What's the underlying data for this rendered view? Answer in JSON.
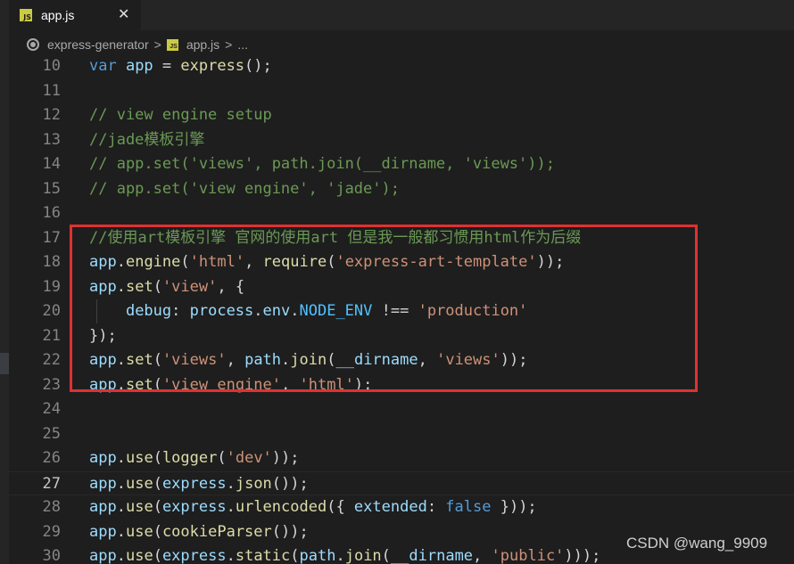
{
  "tab": {
    "label": "app.js",
    "close": "✕",
    "badge": "JS"
  },
  "breadcrumb": {
    "items": [
      "express-generator",
      "app.js",
      "..."
    ],
    "sep": ">",
    "badge": "JS"
  },
  "editor": {
    "lines": [
      {
        "n": "10",
        "code": [
          [
            "k",
            "var "
          ],
          [
            "v",
            "app"
          ],
          [
            "o",
            " = "
          ],
          [
            "f",
            "express"
          ],
          [
            "p",
            "();"
          ]
        ]
      },
      {
        "n": "11",
        "code": []
      },
      {
        "n": "12",
        "code": [
          [
            "c",
            "// view engine setup"
          ]
        ]
      },
      {
        "n": "13",
        "code": [
          [
            "c",
            "//jade模板引擎"
          ]
        ]
      },
      {
        "n": "14",
        "code": [
          [
            "c",
            "// app.set('views', path.join(__dirname, 'views'));"
          ]
        ]
      },
      {
        "n": "15",
        "code": [
          [
            "c",
            "// app.set('view engine', 'jade');"
          ]
        ]
      },
      {
        "n": "16",
        "code": []
      },
      {
        "n": "17",
        "code": [
          [
            "c",
            "//使用art模板引擎 官网的使用art 但是我一般都习惯用html作为后缀"
          ]
        ]
      },
      {
        "n": "18",
        "code": [
          [
            "v",
            "app"
          ],
          [
            "p",
            "."
          ],
          [
            "f",
            "engine"
          ],
          [
            "p",
            "("
          ],
          [
            "s",
            "'html'"
          ],
          [
            "p",
            ", "
          ],
          [
            "f",
            "require"
          ],
          [
            "p",
            "("
          ],
          [
            "s",
            "'express-art-template'"
          ],
          [
            "p",
            "));"
          ]
        ]
      },
      {
        "n": "19",
        "code": [
          [
            "v",
            "app"
          ],
          [
            "p",
            "."
          ],
          [
            "f",
            "set"
          ],
          [
            "p",
            "("
          ],
          [
            "s",
            "'view'"
          ],
          [
            "p",
            ", {"
          ]
        ]
      },
      {
        "n": "20",
        "code": [
          [
            "p",
            "    "
          ],
          [
            "v",
            "debug"
          ],
          [
            "p",
            ": "
          ],
          [
            "v",
            "process"
          ],
          [
            "p",
            "."
          ],
          [
            "v",
            "env"
          ],
          [
            "p",
            "."
          ],
          [
            "con",
            "NODE_ENV"
          ],
          [
            "o",
            " !== "
          ],
          [
            "s",
            "'production'"
          ]
        ],
        "guide": true
      },
      {
        "n": "21",
        "code": [
          [
            "p",
            "});"
          ]
        ]
      },
      {
        "n": "22",
        "code": [
          [
            "v",
            "app"
          ],
          [
            "p",
            "."
          ],
          [
            "f",
            "set"
          ],
          [
            "p",
            "("
          ],
          [
            "s",
            "'views'"
          ],
          [
            "p",
            ", "
          ],
          [
            "v",
            "path"
          ],
          [
            "p",
            "."
          ],
          [
            "f",
            "join"
          ],
          [
            "p",
            "("
          ],
          [
            "v",
            "__dirname"
          ],
          [
            "p",
            ", "
          ],
          [
            "s",
            "'views'"
          ],
          [
            "p",
            "));"
          ]
        ]
      },
      {
        "n": "23",
        "code": [
          [
            "v",
            "app"
          ],
          [
            "p",
            "."
          ],
          [
            "f",
            "set"
          ],
          [
            "p",
            "("
          ],
          [
            "s",
            "'view engine'"
          ],
          [
            "p",
            ", "
          ],
          [
            "s",
            "'html'"
          ],
          [
            "p",
            ");"
          ]
        ]
      },
      {
        "n": "24",
        "code": []
      },
      {
        "n": "25",
        "code": []
      },
      {
        "n": "26",
        "code": [
          [
            "v",
            "app"
          ],
          [
            "p",
            "."
          ],
          [
            "f",
            "use"
          ],
          [
            "p",
            "("
          ],
          [
            "f",
            "logger"
          ],
          [
            "p",
            "("
          ],
          [
            "s",
            "'dev'"
          ],
          [
            "p",
            "));"
          ]
        ]
      },
      {
        "n": "27",
        "code": [
          [
            "v",
            "app"
          ],
          [
            "p",
            "."
          ],
          [
            "f",
            "use"
          ],
          [
            "p",
            "("
          ],
          [
            "v",
            "express"
          ],
          [
            "p",
            "."
          ],
          [
            "f",
            "json"
          ],
          [
            "p",
            "());"
          ]
        ],
        "current": true
      },
      {
        "n": "28",
        "code": [
          [
            "v",
            "app"
          ],
          [
            "p",
            "."
          ],
          [
            "f",
            "use"
          ],
          [
            "p",
            "("
          ],
          [
            "v",
            "express"
          ],
          [
            "p",
            "."
          ],
          [
            "f",
            "urlencoded"
          ],
          [
            "p",
            "({ "
          ],
          [
            "v",
            "extended"
          ],
          [
            "p",
            ": "
          ],
          [
            "k",
            "false"
          ],
          [
            "p",
            " }));"
          ]
        ]
      },
      {
        "n": "29",
        "code": [
          [
            "v",
            "app"
          ],
          [
            "p",
            "."
          ],
          [
            "f",
            "use"
          ],
          [
            "p",
            "("
          ],
          [
            "f",
            "cookieParser"
          ],
          [
            "p",
            "());"
          ]
        ]
      },
      {
        "n": "30",
        "code": [
          [
            "v",
            "app"
          ],
          [
            "p",
            "."
          ],
          [
            "f",
            "use"
          ],
          [
            "p",
            "("
          ],
          [
            "v",
            "express"
          ],
          [
            "p",
            "."
          ],
          [
            "f",
            "static"
          ],
          [
            "p",
            "("
          ],
          [
            "v",
            "path"
          ],
          [
            "p",
            "."
          ],
          [
            "f",
            "join"
          ],
          [
            "p",
            "("
          ],
          [
            "v",
            "__dirname"
          ],
          [
            "p",
            ", "
          ],
          [
            "s",
            "'public'"
          ],
          [
            "p",
            ")));"
          ]
        ]
      }
    ]
  },
  "watermark": "CSDN @wang_9909",
  "colors": {
    "highlight_box": "#e03131",
    "js_badge": "#cbcb41"
  }
}
